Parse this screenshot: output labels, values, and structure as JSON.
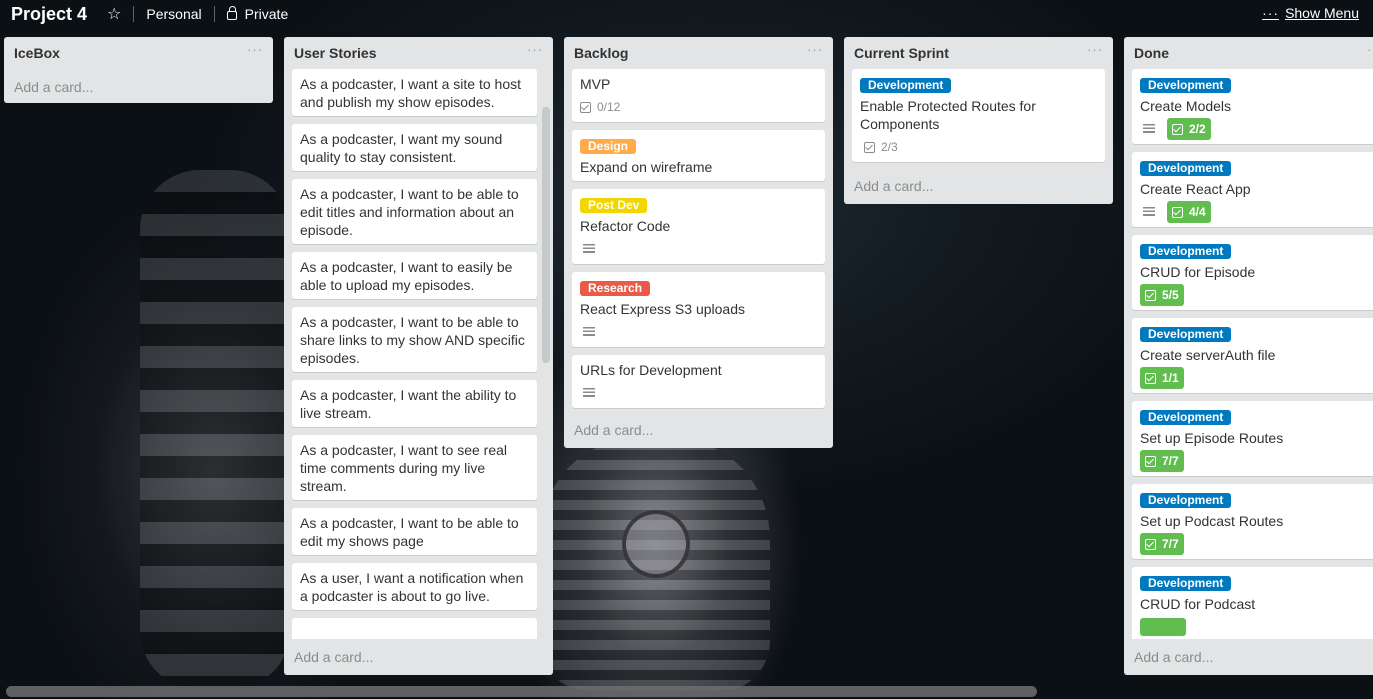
{
  "board": {
    "title": "Project 4",
    "team": "Personal",
    "visibility": "Private",
    "show_menu": "Show Menu",
    "menu_dots": "···"
  },
  "colors": {
    "development": "#0079bf",
    "design": "#ffab4a",
    "post_dev": "#f2d600",
    "research": "#eb5a46",
    "checklist_complete": "#61bd4f"
  },
  "lists": [
    {
      "title": "IceBox",
      "add_card": "Add a card..."
    },
    {
      "title": "User Stories",
      "add_card": "Add a card...",
      "cards": [
        "As a podcaster, I want a site to host and publish my show episodes.",
        "As a podcaster, I want my sound quality to stay consistent.",
        "As a podcaster, I want to be able to edit titles and information about an episode.",
        "As a podcaster, I want to easily be able to upload my episodes.",
        "As a podcaster, I want to be able to share links to my show AND specific episodes.",
        "As a podcaster, I want the ability to live stream.",
        "As a podcaster, I want to see real time comments during my live stream.",
        "As a podcaster, I want to be able to edit my shows page",
        "As a user, I want a notification when a podcaster is about to go live."
      ]
    },
    {
      "title": "Backlog",
      "add_card": "Add a card...",
      "cards": [
        {
          "title": "MVP",
          "checklist": "0/12"
        },
        {
          "label": "Design",
          "title": "Expand on wireframe"
        },
        {
          "label": "Post Dev",
          "title": "Refactor Code"
        },
        {
          "label": "Research",
          "title": "React Express S3 uploads"
        },
        {
          "title": "URLs for Development"
        }
      ]
    },
    {
      "title": "Current Sprint",
      "add_card": "Add a card...",
      "cards": [
        {
          "label": "Development",
          "title": "Enable Protected Routes for Components",
          "checklist": "2/3"
        }
      ]
    },
    {
      "title": "Done",
      "add_card": "Add a card...",
      "cards": [
        {
          "label": "Development",
          "title": "Create Models",
          "checklist": "2/2"
        },
        {
          "label": "Development",
          "title": "Create React App",
          "checklist": "4/4"
        },
        {
          "label": "Development",
          "title": "CRUD for Episode",
          "checklist": "5/5"
        },
        {
          "label": "Development",
          "title": "Create serverAuth file",
          "checklist": "1/1"
        },
        {
          "label": "Development",
          "title": "Set up Episode Routes",
          "checklist": "7/7"
        },
        {
          "label": "Development",
          "title": "Set up Podcast Routes",
          "checklist": "7/7"
        },
        {
          "label": "Development",
          "title": "CRUD for Podcast"
        }
      ]
    }
  ]
}
